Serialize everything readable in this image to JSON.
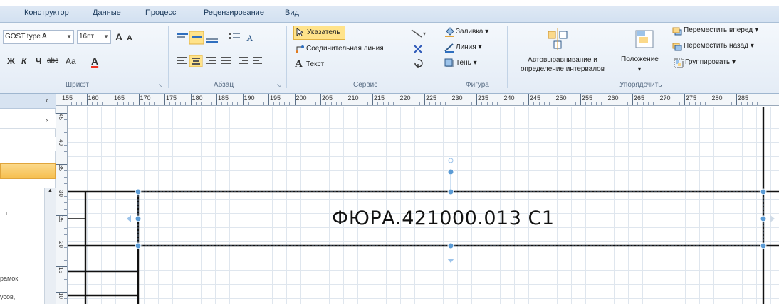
{
  "ribbon": {
    "tabs": [
      {
        "label": "Конструктор"
      },
      {
        "label": "Данные"
      },
      {
        "label": "Процесс"
      },
      {
        "label": "Рецензирование"
      },
      {
        "label": "Вид"
      }
    ],
    "font": {
      "family_value": "GOST type A",
      "size_value": "16пт",
      "grow_label": "A",
      "shrink_label": "A",
      "bold_label": "Ж",
      "italic_label": "К",
      "underline_label": "Ч",
      "strike_label": "abc",
      "case_label": "Aa",
      "color_label": "A",
      "group_label": "Шрифт"
    },
    "paragraph": {
      "group_label": "Абзац"
    },
    "tools": {
      "pointer_label": "Указатель",
      "connector_label": "Соединительная линия",
      "text_label": "Текст",
      "group_label": "Сервис"
    },
    "shape": {
      "fill_label": "Заливка",
      "line_label": "Линия",
      "shadow_label": "Тень",
      "group_label": "Фигура"
    },
    "arrange": {
      "autoalign_label_1": "Автовыравнивание и",
      "autoalign_label_2": "определение интервалов",
      "position_label": "Положение",
      "bring_forward_label": "Переместить вперед",
      "send_backward_label": "Переместить назад",
      "group_btn_label": "Группировать",
      "group_label": "Упорядочить"
    }
  },
  "left_panel": {
    "text_1": "г",
    "text_2": "рамок",
    "text_3": "усов,"
  },
  "ruler": {
    "marks": [
      "155",
      "160",
      "165",
      "170",
      "175",
      "180",
      "185",
      "190",
      "195",
      "200",
      "205",
      "210",
      "215",
      "220",
      "225",
      "230",
      "235",
      "240",
      "245",
      "250",
      "255",
      "260",
      "265",
      "270",
      "275",
      "280",
      "285"
    ],
    "v_marks": [
      "45",
      "40",
      "35",
      "30",
      "25",
      "20",
      "15",
      "10"
    ]
  },
  "drawing": {
    "stamp_text": "ФЮРА.421000.013 С1"
  },
  "colors": {
    "accent": "#ffe38a",
    "selection": "#5b9bd5"
  }
}
